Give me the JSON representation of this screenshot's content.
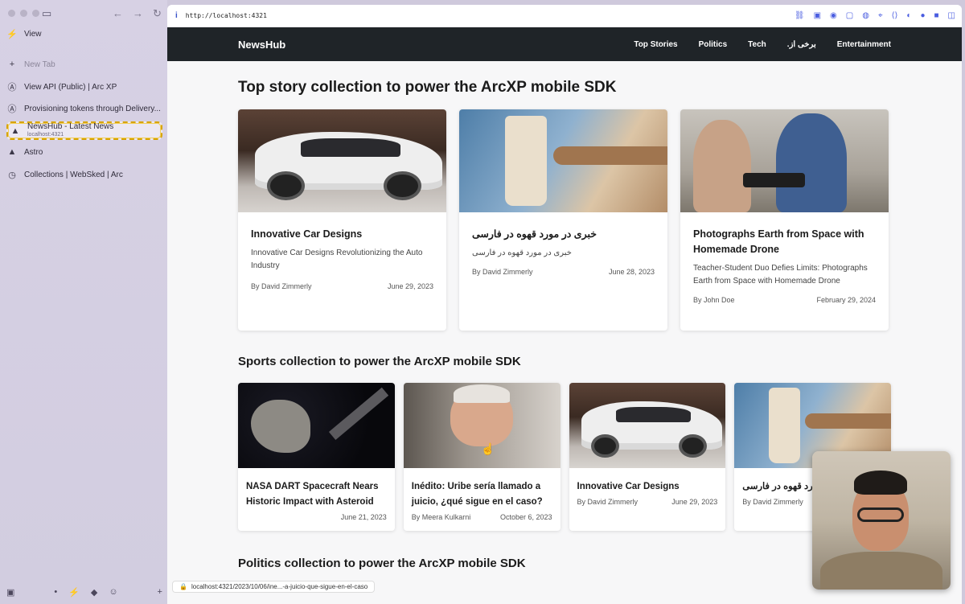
{
  "sidebar": {
    "items": [
      {
        "label": "View",
        "icon": "bolt-icon"
      },
      {
        "label": "New Tab",
        "icon": "plus-icon"
      },
      {
        "label": "View API (Public) | Arc XP",
        "icon": "arc-icon"
      },
      {
        "label": "Provisioning tokens through Delivery...",
        "icon": "arc-icon"
      },
      {
        "label": "NewsHub - Latest News",
        "sublabel": "localhost:4321",
        "icon": "astro-icon"
      },
      {
        "label": "Astro",
        "icon": "astro-icon"
      },
      {
        "label": "Collections | WebSked | Arc",
        "icon": "websked-icon"
      }
    ]
  },
  "browser": {
    "url": "http://localhost:4321",
    "status_url": "localhost:4321/2023/10/06/ine...-a-juicio-que-sigue-en-el-caso"
  },
  "site": {
    "brand": "NewsHub",
    "nav": [
      "Top Stories",
      "Politics",
      "Tech",
      ".برخی از",
      "Entertainment"
    ]
  },
  "top_section": {
    "title": "Top story collection to power the ArcXP mobile SDK",
    "cards": [
      {
        "title": "Innovative Car Designs",
        "description": "Innovative Car Designs Revolutionizing the Auto Industry",
        "author": "By David Zimmerly",
        "date": "June 29, 2023"
      },
      {
        "title": "خبری در مورد قهوه در فارسی",
        "description": "خبری در مورد قهوه در فارسی",
        "author": "By David Zimmerly",
        "date": "June 28, 2023"
      },
      {
        "title": "Photographs Earth from Space with Homemade Drone",
        "description": "Teacher-Student Duo Defies Limits: Photographs Earth from Space with Homemade Drone",
        "author": "By John Doe",
        "date": "February 29, 2024"
      }
    ]
  },
  "sports_section": {
    "title": "Sports collection to power the ArcXP mobile SDK",
    "cards": [
      {
        "title": "NASA DART Spacecraft Nears Historic Impact with Asteroid",
        "author": "",
        "date": "June 21, 2023"
      },
      {
        "title": "Inédito: Uribe sería llamado a juicio, ¿qué sigue en el caso?",
        "author": "By Meera Kulkarni",
        "date": "October 6, 2023"
      },
      {
        "title": "Innovative Car Designs",
        "author": "By David Zimmerly",
        "date": "June 29, 2023"
      },
      {
        "title": "خبری در مورد قهوه در فارسی",
        "author": "By David Zimmerly",
        "date": ""
      }
    ]
  },
  "politics_section": {
    "title": "Politics collection to power the ArcXP mobile SDK"
  }
}
